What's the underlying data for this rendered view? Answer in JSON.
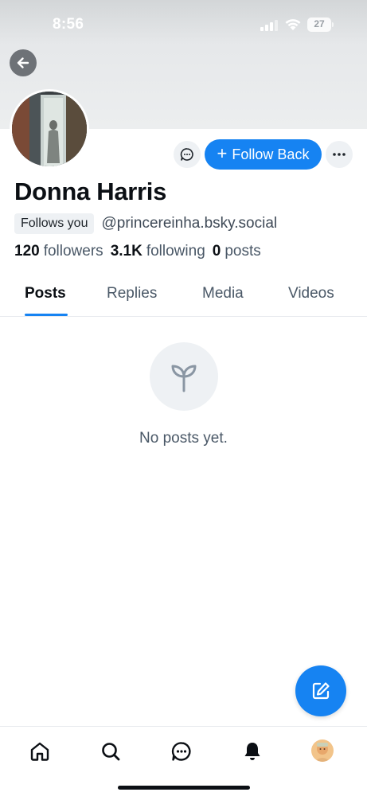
{
  "status_bar": {
    "time": "8:56",
    "battery": "27"
  },
  "profile": {
    "display_name": "Donna Harris",
    "follows_you_badge": "Follows you",
    "handle": "@princereinha.bsky.social",
    "stats": {
      "followers_count": "120",
      "followers_label": "followers",
      "following_count": "3.1K",
      "following_label": "following",
      "posts_count": "0",
      "posts_label": "posts"
    }
  },
  "actions": {
    "follow_back_label": "Follow Back",
    "follow_plus": "+"
  },
  "tabs": [
    {
      "label": "Posts",
      "active": true
    },
    {
      "label": "Replies",
      "active": false
    },
    {
      "label": "Media",
      "active": false
    },
    {
      "label": "Videos",
      "active": false
    }
  ],
  "empty_state": {
    "message": "No posts yet.",
    "icon": "seedling-icon"
  },
  "bottom_nav": [
    "home-icon",
    "search-icon",
    "chat-icon",
    "bell-icon",
    "profile-avatar"
  ],
  "colors": {
    "accent": "#1683f2",
    "muted_bg": "#eef1f4",
    "muted_text": "#4a5867"
  }
}
